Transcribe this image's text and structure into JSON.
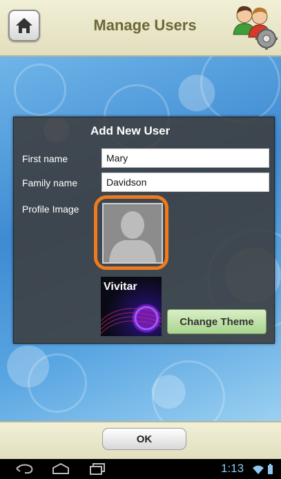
{
  "header": {
    "title": "Manage Users"
  },
  "dialog": {
    "title": "Add New User",
    "first_name_label": "First name",
    "first_name_value": "Mary",
    "family_name_label": "Family name",
    "family_name_value": "Davidson",
    "profile_image_label": "Profile Image",
    "theme_logo_text": "Vivitar",
    "change_theme_label": "Change Theme"
  },
  "footer": {
    "ok_label": "OK"
  },
  "status_bar": {
    "time": "1:13"
  },
  "colors": {
    "accent_orange": "#f07a1c",
    "header_bg": "#ebe8cb",
    "change_theme_bg": "#bfe0a8"
  },
  "icons": [
    "home-icon",
    "users-gear-icon",
    "back-icon",
    "home-nav-icon",
    "recents-icon",
    "wifi-icon",
    "battery-icon"
  ]
}
